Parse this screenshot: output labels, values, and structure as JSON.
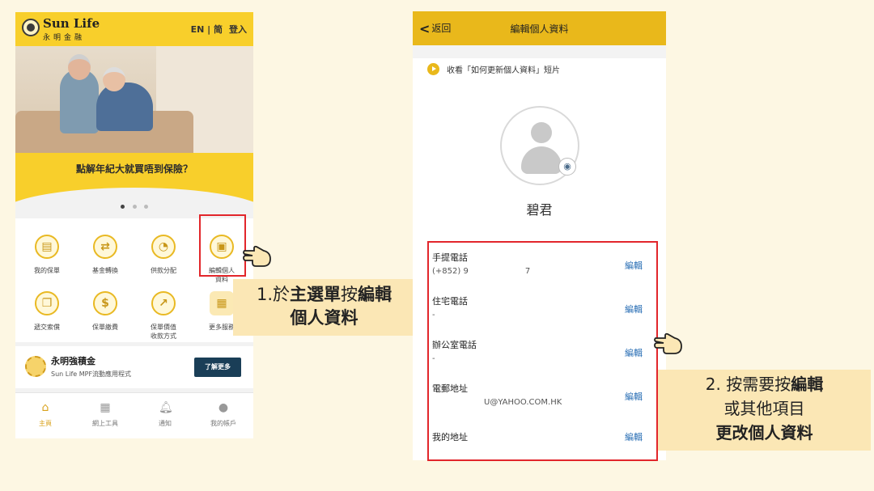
{
  "left_phone": {
    "brand_en": "Sun Life",
    "brand_zh": "永明金融",
    "lang": "EN | 简",
    "login": "登入",
    "banner_text": "點解年紀大就買唔到保險？",
    "menu": [
      {
        "label": "我的保單",
        "icon": "policy-icon"
      },
      {
        "label": "基金轉換",
        "icon": "fund-switch-icon"
      },
      {
        "label": "供款分配",
        "icon": "pie-chart-icon"
      },
      {
        "label": "編輯個人\n資料",
        "icon": "profile-card-icon"
      },
      {
        "label": "遞交索償",
        "icon": "claim-icon"
      },
      {
        "label": "保單繳費",
        "icon": "payment-icon"
      },
      {
        "label": "保單價值\n收款方式",
        "icon": "value-payout-icon"
      },
      {
        "label": "更多服務",
        "icon": "more-services-icon"
      }
    ],
    "mpf": {
      "title": "永明強積金",
      "subtitle": "Sun Life MPF流動應用程式",
      "button": "了解更多"
    },
    "tabs": [
      {
        "label": "主頁",
        "icon": "home-icon",
        "active": true
      },
      {
        "label": "網上工具",
        "icon": "calculator-icon",
        "active": false
      },
      {
        "label": "通知",
        "icon": "bell-icon",
        "active": false
      },
      {
        "label": "我的帳戶",
        "icon": "account-icon",
        "active": false
      }
    ]
  },
  "note1": {
    "line1_a": "1.於",
    "line1_b": "主選單",
    "line1_c": "按",
    "line1_d": "編輯",
    "line2": "個人資料"
  },
  "right_phone": {
    "back": "返回",
    "title": "編輯個人資料",
    "video_link": "收看「如何更新個人資料」短片",
    "user_name": "碧君",
    "fields": [
      {
        "label": "手提電話",
        "value": "(+852) 9",
        "value_tail": "7",
        "edit": "編輯"
      },
      {
        "label": "住宅電話",
        "value": "-",
        "edit": "編輯"
      },
      {
        "label": "辦公室電話",
        "value": "-",
        "edit": "編輯"
      },
      {
        "label": "電郵地址",
        "value": "U@YAHOO.COM.HK",
        "edit": "編輯"
      },
      {
        "label": "我的地址",
        "value": "",
        "edit": "編輯"
      }
    ]
  },
  "note2": {
    "line1_a": "2. 按需要按",
    "line1_b": "編輯",
    "line2": "或其他項目",
    "line3": "更改個人資料"
  },
  "colors": {
    "brand_yellow": "#f8cf2b",
    "header_yellow": "#e9b81b",
    "highlight_red": "#e2262b",
    "note_bg": "#fbe7b5",
    "link_blue": "#2a6fb5",
    "button_navy": "#1a3e57"
  }
}
